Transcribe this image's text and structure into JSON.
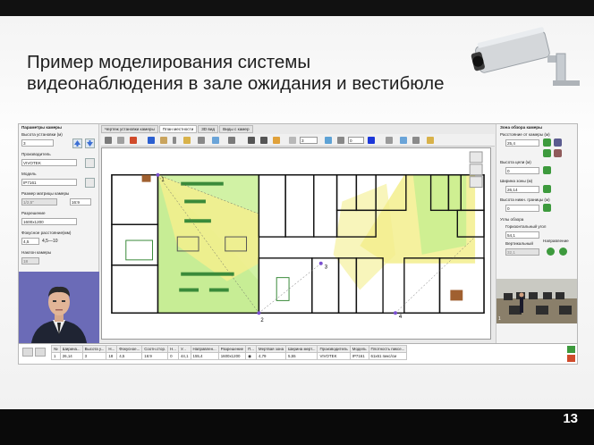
{
  "slide": {
    "title": "Пример моделирования системы видеонаблюдения в зале ожидания и вестибюле",
    "page_number": "13"
  },
  "app": {
    "tabs": [
      {
        "label": "Чертеж установки камеры"
      },
      {
        "label": "План местности"
      },
      {
        "label": "3D вид"
      },
      {
        "label": "Виды с камер"
      }
    ],
    "toolbar": {
      "num1": "3",
      "num2": "0"
    },
    "left_panel": {
      "header": "Параметры камеры",
      "mount_height_label": "Высота установки (м)",
      "mount_height_value": "3",
      "manufacturer_label": "Производитель",
      "manufacturer_value": "VIVOTEK",
      "model_label": "Модель",
      "model_value": "IP7161",
      "matrix_label": "Размер матрицы камеры",
      "matrix_value": "1/2,5\"",
      "matrix_ratio": "16:9",
      "resolution_label": "Разрешение",
      "resolution_value": "1600x1200",
      "focal_label": "Фокусное расстояние(мм)",
      "focal_value": "4,5",
      "focal_range": "4,5—10",
      "tilt_label": "Наклон камеры",
      "tilt_value": "18"
    },
    "right_panel": {
      "header": "Зона обзора камеры",
      "distance_label": "Расстояние от камеры (м)",
      "distance_value": "25,4",
      "target_height_label": "Высота цели (м)",
      "target_height_value": "0",
      "zone_width_label": "Ширина зоны (м)",
      "zone_width_value": "26,14",
      "lower_bound_label": "Высота нижн. границы (м)",
      "lower_bound_value": "0",
      "angles_header": "Углы обзора",
      "h_angle_label": "Горизонтальный угол",
      "h_angle_value": "54,1",
      "v_angle_label": "Вертикальный",
      "v_angle_value": "32,1",
      "direction_label": "Направление",
      "view_number": "1"
    },
    "plan": {
      "camera_markers": [
        "1",
        "2",
        "3",
        "4"
      ]
    },
    "table": {
      "headers": [
        "№",
        "Ширина...",
        "Высота у...",
        "Н...",
        "Фокусное...",
        "Соотн.стор.",
        "Н...",
        "У...",
        "Направлен...",
        "Разрешение",
        "П...",
        "Мертвая зона",
        "Ширина мерт...",
        "Производитель",
        "Модель",
        "Плотность пиксе..."
      ],
      "row": [
        "1",
        "26,14",
        "3",
        "18",
        "4,5",
        "16:9",
        "0",
        "44,1",
        "155,4",
        "1600x1200",
        "",
        "4,79",
        "5,55",
        "VIVOTEK",
        "IP7161",
        "61x61 пикс/см"
      ]
    }
  },
  "colors": {
    "zone_green": "#c6ef8f",
    "zone_yellow": "#f3ee8d",
    "avatar_bg": "#6b6bb7",
    "toolbar_blue": "#2b5fd0"
  }
}
